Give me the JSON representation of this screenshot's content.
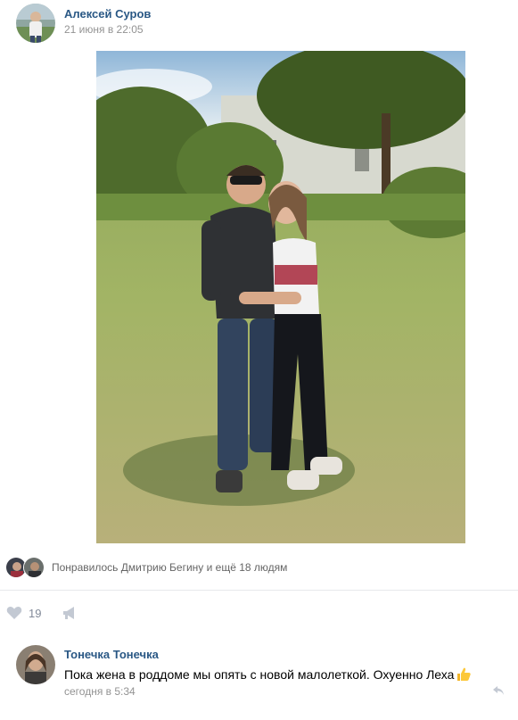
{
  "post": {
    "author_name": "Алексей Суров",
    "date": "21 июня в 22:05",
    "avatar_icon": "user-avatar",
    "photo_icon": "couple-photo"
  },
  "likes": {
    "likers_text": "Понравилось Дмитрию Бегину и ещё 18 людям",
    "count": "19",
    "like_color": "#c3c9d3",
    "link_color": "#2a5885"
  },
  "comment": {
    "author_name": "Тонечка Тонечка",
    "text": "Пока жена в роддоме мы опять с новой малолеткой. Охуенно Леха",
    "emoji": "thumbs-up-emoji",
    "time": "сегодня в 5:34"
  }
}
